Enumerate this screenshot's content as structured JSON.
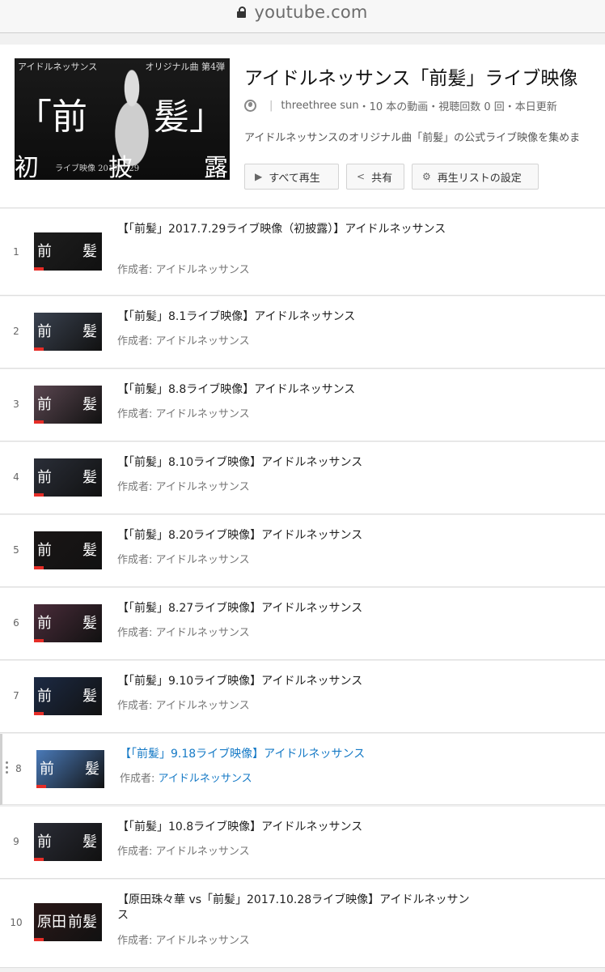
{
  "browser": {
    "url": "youtube.com"
  },
  "playlist": {
    "title": "アイドルネッサンス「前髪」ライブ映像",
    "owner": "threethree sun",
    "stats": "・10 本の動画・視聴回数 0 回・本日更新",
    "description": "アイドルネッサンスのオリジナル曲「前髪」の公式ライブ映像を集めま",
    "thumb_text": {
      "top_left": "アイドルネッサンス",
      "top_right": "オリジナル曲 第4弾",
      "big_left": "「前",
      "big_right": "髪」",
      "bottom_1": "初",
      "bottom_2": "披",
      "bottom_3": "露",
      "date": "ライブ映像 2017.7.29"
    },
    "buttons": {
      "play_all": "すべて再生",
      "share": "共有",
      "settings": "再生リストの設定"
    }
  },
  "author_prefix": "作成者: ",
  "videos": [
    {
      "index": "1",
      "title": "【「前髪」2017.7.29ライブ映像（初披露）】アイドルネッサンス",
      "author": "アイドルネッサンス",
      "thumb_left": "前",
      "thumb_right": "髪",
      "thumb_color": "#1e1e1e"
    },
    {
      "index": "2",
      "title": "【「前髪」8.1ライブ映像】アイドルネッサンス",
      "author": "アイドルネッサンス",
      "thumb_left": "前",
      "thumb_right": "髪",
      "thumb_color": "#3a4250"
    },
    {
      "index": "3",
      "title": "【「前髪」8.8ライブ映像】アイドルネッサンス",
      "author": "アイドルネッサンス",
      "thumb_left": "前",
      "thumb_right": "髪",
      "thumb_color": "#5a4650"
    },
    {
      "index": "4",
      "title": "【「前髪」8.10ライブ映像】アイドルネッサンス",
      "author": "アイドルネッサンス",
      "thumb_left": "前",
      "thumb_right": "髪",
      "thumb_color": "#2a2e38"
    },
    {
      "index": "5",
      "title": "【「前髪」8.20ライブ映像】アイドルネッサンス",
      "author": "アイドルネッサンス",
      "thumb_left": "前",
      "thumb_right": "髪",
      "thumb_color": "#1a1616"
    },
    {
      "index": "6",
      "title": "【「前髪」8.27ライブ映像】アイドルネッサンス",
      "author": "アイドルネッサンス",
      "thumb_left": "前",
      "thumb_right": "髪",
      "thumb_color": "#4a2c3a"
    },
    {
      "index": "7",
      "title": "【「前髪」9.10ライブ映像】アイドルネッサンス",
      "author": "アイドルネッサンス",
      "thumb_left": "前",
      "thumb_right": "髪",
      "thumb_color": "#1c2a44"
    },
    {
      "index": "8",
      "title": "【「前髪」9.18ライブ映像】アイドルネッサンス",
      "author": "アイドルネッサンス",
      "thumb_left": "前",
      "thumb_right": "髪",
      "thumb_color": "#4a7ab8",
      "selected": true
    },
    {
      "index": "9",
      "title": "【「前髪」10.8ライブ映像】アイドルネッサンス",
      "author": "アイドルネッサンス",
      "thumb_left": "前",
      "thumb_right": "髪",
      "thumb_color": "#2a2c36"
    },
    {
      "index": "10",
      "title": "【原田珠々華 vs「前髪」2017.10.28ライブ映像】アイドルネッサンス",
      "author": "アイドルネッサンス",
      "thumb_left": "原田",
      "thumb_right": "前髪",
      "thumb_color": "#2a1818"
    }
  ]
}
